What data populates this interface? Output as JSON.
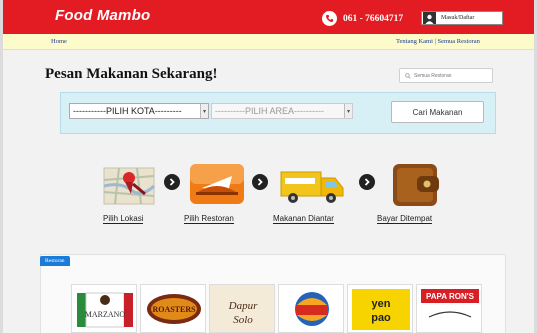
{
  "header": {
    "logo": "Food Mambo",
    "phone": "061 - 76604717",
    "login_label": "Masuk/Daftar"
  },
  "nav": {
    "home": "Home",
    "about": "Tentang Kami",
    "separator": "|",
    "all_restaurants": "Semua Restoran"
  },
  "main": {
    "title": "Pesan Makanan Sekarang!",
    "search_placeholder": "Semua Restoran"
  },
  "search_panel": {
    "city_select": "-----------PILIH KOTA---------",
    "area_select": "----------PILIH AREA----------",
    "submit_label": "Cari Makanan"
  },
  "steps": [
    {
      "label": "Pilih Lokasi",
      "icon": "map-pin-icon"
    },
    {
      "label": "Pilih Restoran",
      "icon": "restaurant-tray-icon"
    },
    {
      "label": "Makanan Diantar",
      "icon": "delivery-truck-icon"
    },
    {
      "label": "Bayar Ditempat",
      "icon": "wallet-icon"
    }
  ],
  "restaurants": {
    "tab_label": "Restoran",
    "logos": [
      "Marzano",
      "Roaster's",
      "Dapur Solo",
      "Burger King",
      "Yen Pao",
      "Papa Ron's"
    ]
  },
  "colors": {
    "brand_red": "#e31b23",
    "nav_bg": "#fdfbc9",
    "panel_bg": "#d7f0f5",
    "tab_blue": "#1a7bd8"
  }
}
